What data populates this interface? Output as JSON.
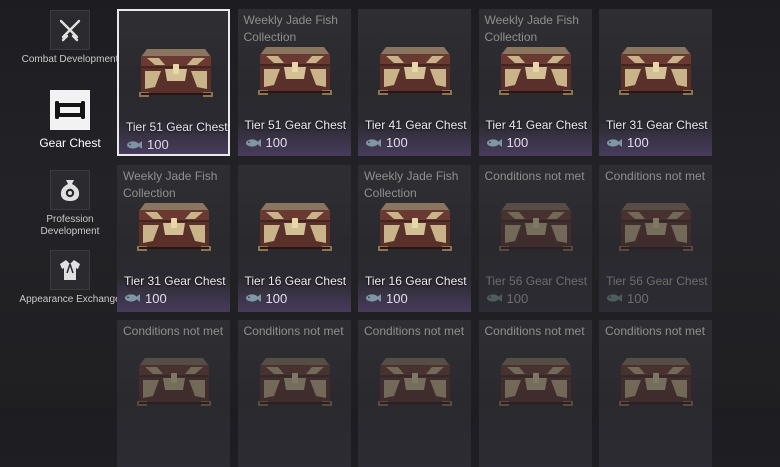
{
  "sidebar": {
    "items": [
      {
        "label": "Combat Development",
        "icon": "crossed-swords-icon",
        "active": false
      },
      {
        "label": "Gear Chest",
        "icon": "chest-scroll-icon",
        "active": true
      },
      {
        "label": "Profession Development",
        "icon": "coin-bag-icon",
        "active": false
      },
      {
        "label": "Appearance Exchange",
        "icon": "robe-icon",
        "active": false
      }
    ]
  },
  "currency": {
    "icon": "jade-fish-icon"
  },
  "colors": {
    "selected_border": "#e9e9e9",
    "dim_text": "#6d6d6d",
    "glow": "#7a5aaa"
  },
  "cards": [
    {
      "note": "",
      "name": "Tier 51 Gear Chest",
      "cost": "100",
      "state": "selected"
    },
    {
      "note": "Weekly Jade Fish Collection",
      "name": "Tier 51 Gear Chest",
      "cost": "100",
      "state": "available"
    },
    {
      "note": "",
      "name": "Tier 41 Gear Chest",
      "cost": "100",
      "state": "available"
    },
    {
      "note": "Weekly Jade Fish Collection",
      "name": "Tier 41 Gear Chest",
      "cost": "100",
      "state": "available"
    },
    {
      "note": "",
      "name": "Tier 31 Gear Chest",
      "cost": "100",
      "state": "available"
    },
    {
      "note": "Weekly Jade Fish Collection",
      "name": "Tier 31 Gear Chest",
      "cost": "100",
      "state": "available"
    },
    {
      "note": "",
      "name": "Tier 16 Gear Chest",
      "cost": "100",
      "state": "available"
    },
    {
      "note": "Weekly Jade Fish Collection",
      "name": "Tier 16 Gear Chest",
      "cost": "100",
      "state": "available"
    },
    {
      "note": "Conditions not met",
      "name": "Tier 56 Gear Chest",
      "cost": "100",
      "state": "locked"
    },
    {
      "note": "Conditions not met",
      "name": "Tier 56 Gear Chest",
      "cost": "100",
      "state": "locked"
    },
    {
      "note": "Conditions not met",
      "name": "",
      "cost": "",
      "state": "locked"
    },
    {
      "note": "Conditions not met",
      "name": "",
      "cost": "",
      "state": "locked"
    },
    {
      "note": "Conditions not met",
      "name": "",
      "cost": "",
      "state": "locked"
    },
    {
      "note": "Conditions not met",
      "name": "",
      "cost": "",
      "state": "locked"
    },
    {
      "note": "Conditions not met",
      "name": "",
      "cost": "",
      "state": "locked"
    }
  ]
}
